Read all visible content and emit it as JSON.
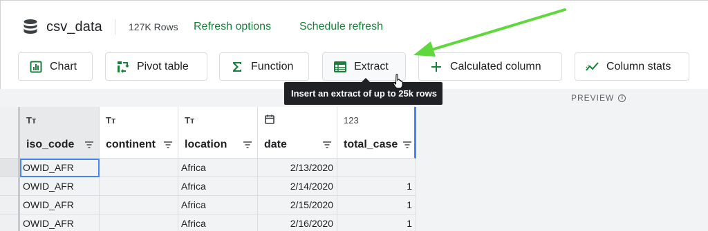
{
  "header": {
    "dataset_name": "csv_data",
    "row_count": "127K Rows",
    "refresh_options": "Refresh options",
    "schedule_refresh": "Schedule refresh"
  },
  "toolbar": {
    "chart": "Chart",
    "pivot_table": "Pivot table",
    "function": "Function",
    "extract": "Extract",
    "calculated_column": "Calculated column",
    "column_stats": "Column stats"
  },
  "tooltip": "Insert an extract of up to 25k rows",
  "preview_label": "PREVIEW",
  "columns": [
    {
      "type": "Tт",
      "name": "iso_code"
    },
    {
      "type": "Tт",
      "name": "continent"
    },
    {
      "type": "Tт",
      "name": "location"
    },
    {
      "type": "calendar-icon",
      "name": "date"
    },
    {
      "type": "123",
      "name": "total_case"
    }
  ],
  "rows": [
    [
      "OWID_AFR",
      "",
      "Africa",
      "2/13/2020",
      ""
    ],
    [
      "OWID_AFR",
      "",
      "Africa",
      "2/14/2020",
      "1"
    ],
    [
      "OWID_AFR",
      "",
      "Africa",
      "2/15/2020",
      "1"
    ],
    [
      "OWID_AFR",
      "",
      "Africa",
      "2/16/2020",
      "1"
    ]
  ],
  "colors": {
    "link_green": "#188038",
    "annotation_arrow": "#5fd83e",
    "accent_blue": "#4285f4"
  }
}
